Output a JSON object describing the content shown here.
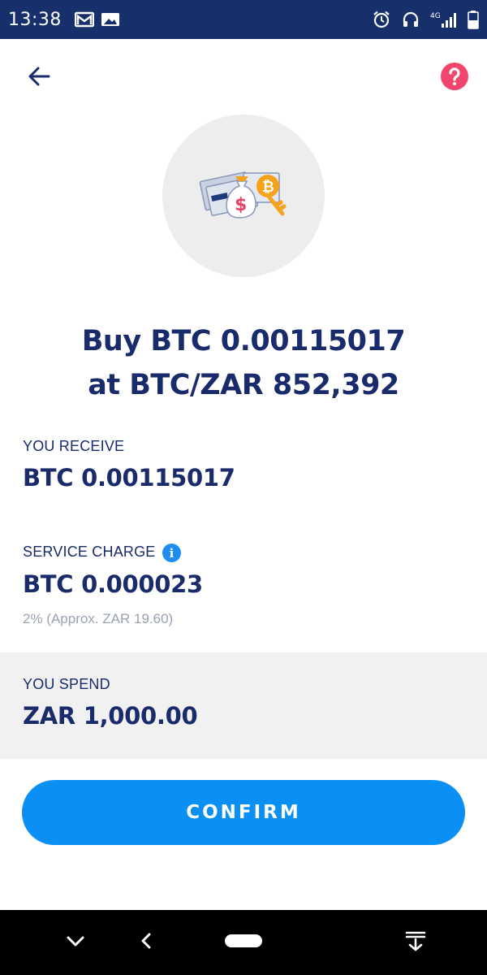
{
  "status_bar": {
    "time": "13:38",
    "left_icons": [
      "gmail-icon",
      "image-icon"
    ],
    "right_icons": [
      "alarm-icon",
      "headphones-icon",
      "signal-4g-icon",
      "battery-icon"
    ],
    "network": "4G"
  },
  "header": {
    "back_icon": "arrow-left-icon",
    "help_icon": "help-icon"
  },
  "headline": {
    "line1": "Buy BTC 0.00115017",
    "line2": "at BTC/ZAR 852,392"
  },
  "receive": {
    "label": "YOU RECEIVE",
    "value": "BTC 0.00115017"
  },
  "service_charge": {
    "label": "SERVICE CHARGE",
    "value": "BTC 0.000023",
    "note": "2% (Approx. ZAR 19.60)",
    "info_glyph": "i"
  },
  "spend": {
    "label": "YOU SPEND",
    "value": "ZAR 1,000.00"
  },
  "confirm_button": {
    "label": "CONFIRM"
  },
  "colors": {
    "status_bar": "#17306b",
    "primary_text": "#1a2b6b",
    "accent_blue": "#0a8ff5",
    "help_pink": "#f0466e",
    "muted_text": "#9aa1b3",
    "panel_bg": "#f1f1f1"
  }
}
